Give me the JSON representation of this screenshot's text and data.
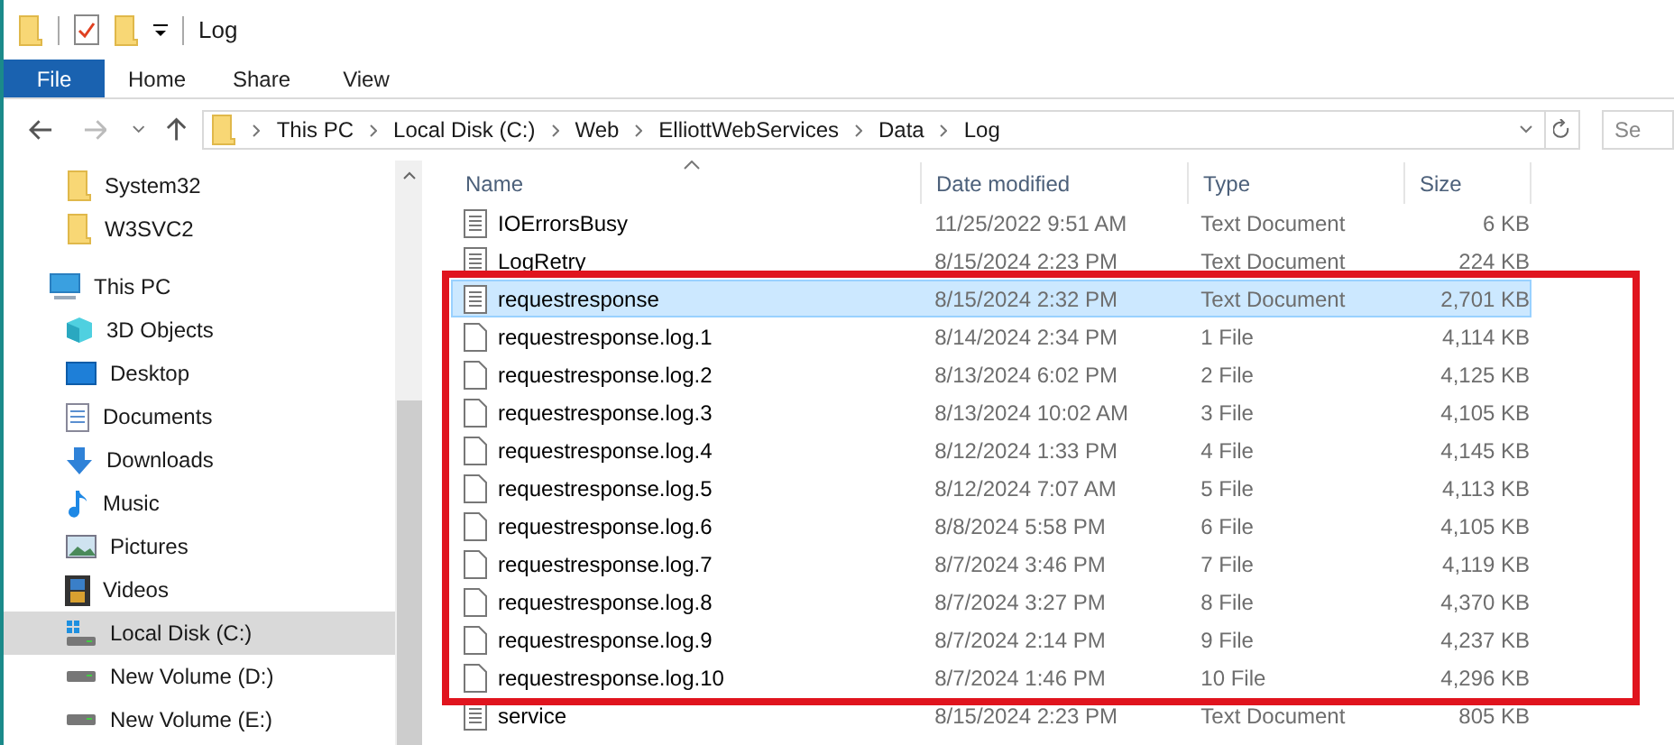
{
  "window": {
    "title": "Log"
  },
  "ribbon_tabs": [
    {
      "label": "File",
      "selected": true
    },
    {
      "label": "Home",
      "selected": false
    },
    {
      "label": "Share",
      "selected": false
    },
    {
      "label": "View",
      "selected": false
    }
  ],
  "breadcrumb": [
    "This PC",
    "Local Disk (C:)",
    "Web",
    "ElliottWebServices",
    "Data",
    "Log"
  ],
  "search": {
    "placeholder": "Se"
  },
  "sidebar": {
    "items": [
      {
        "label": "System32",
        "kind": "folder",
        "selected": false
      },
      {
        "label": "W3SVC2",
        "kind": "folder",
        "selected": false
      },
      {
        "label": "This PC",
        "kind": "pc",
        "selected": false,
        "children": [
          {
            "label": "3D Objects",
            "kind": "cube",
            "selected": false
          },
          {
            "label": "Desktop",
            "kind": "desktop",
            "selected": false
          },
          {
            "label": "Documents",
            "kind": "documents",
            "selected": false
          },
          {
            "label": "Downloads",
            "kind": "downloads",
            "selected": false
          },
          {
            "label": "Music",
            "kind": "music",
            "selected": false
          },
          {
            "label": "Pictures",
            "kind": "pictures",
            "selected": false
          },
          {
            "label": "Videos",
            "kind": "videos",
            "selected": false
          },
          {
            "label": "Local Disk (C:)",
            "kind": "systemdrive",
            "selected": true
          },
          {
            "label": "New Volume (D:)",
            "kind": "drive",
            "selected": false
          },
          {
            "label": "New Volume (E:)",
            "kind": "drive",
            "selected": false
          }
        ]
      }
    ]
  },
  "table": {
    "columns": [
      "Name",
      "Date modified",
      "Type",
      "Size"
    ],
    "rows": [
      {
        "name": "IOErrorsBusy",
        "date": "11/25/2022 9:51 AM",
        "type": "Text Document",
        "size": "6 KB",
        "kind": "text",
        "selected": false
      },
      {
        "name": "LogRetry",
        "date": "8/15/2024 2:23 PM",
        "type": "Text Document",
        "size": "224 KB",
        "kind": "text",
        "selected": false
      },
      {
        "name": "requestresponse",
        "date": "8/15/2024 2:32 PM",
        "type": "Text Document",
        "size": "2,701 KB",
        "kind": "text",
        "selected": true
      },
      {
        "name": "requestresponse.log.1",
        "date": "8/14/2024 2:34 PM",
        "type": "1 File",
        "size": "4,114 KB",
        "kind": "file",
        "selected": false
      },
      {
        "name": "requestresponse.log.2",
        "date": "8/13/2024 6:02 PM",
        "type": "2 File",
        "size": "4,125 KB",
        "kind": "file",
        "selected": false
      },
      {
        "name": "requestresponse.log.3",
        "date": "8/13/2024 10:02 AM",
        "type": "3 File",
        "size": "4,105 KB",
        "kind": "file",
        "selected": false
      },
      {
        "name": "requestresponse.log.4",
        "date": "8/12/2024 1:33 PM",
        "type": "4 File",
        "size": "4,145 KB",
        "kind": "file",
        "selected": false
      },
      {
        "name": "requestresponse.log.5",
        "date": "8/12/2024 7:07 AM",
        "type": "5 File",
        "size": "4,113 KB",
        "kind": "file",
        "selected": false
      },
      {
        "name": "requestresponse.log.6",
        "date": "8/8/2024 5:58 PM",
        "type": "6 File",
        "size": "4,105 KB",
        "kind": "file",
        "selected": false
      },
      {
        "name": "requestresponse.log.7",
        "date": "8/7/2024 3:46 PM",
        "type": "7 File",
        "size": "4,119 KB",
        "kind": "file",
        "selected": false
      },
      {
        "name": "requestresponse.log.8",
        "date": "8/7/2024 3:27 PM",
        "type": "8 File",
        "size": "4,370 KB",
        "kind": "file",
        "selected": false
      },
      {
        "name": "requestresponse.log.9",
        "date": "8/7/2024 2:14 PM",
        "type": "9 File",
        "size": "4,237 KB",
        "kind": "file",
        "selected": false
      },
      {
        "name": "requestresponse.log.10",
        "date": "8/7/2024 1:46 PM",
        "type": "10 File",
        "size": "4,296 KB",
        "kind": "file",
        "selected": false
      },
      {
        "name": "service",
        "date": "8/15/2024 2:23 PM",
        "type": "Text Document",
        "size": "805 KB",
        "kind": "text",
        "selected": false
      }
    ]
  }
}
